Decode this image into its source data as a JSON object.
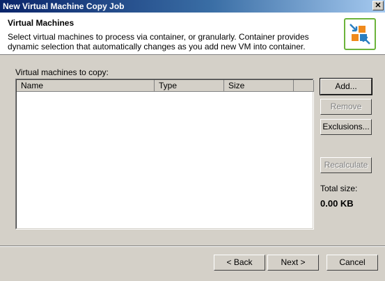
{
  "window": {
    "title": "New Virtual Machine Copy Job",
    "close_icon": "close-icon"
  },
  "header": {
    "title": "Virtual Machines",
    "description": "Select virtual machines to process via container, or granularly. Container provides dynamic selection that automatically changes as you add new VM into container.",
    "logo_icon": "copy-job-arrows-icon"
  },
  "vm_list": {
    "label": "Virtual machines to copy:",
    "columns": [
      "Name",
      "Type",
      "Size"
    ],
    "rows": []
  },
  "side_buttons": {
    "add": "Add...",
    "remove": "Remove",
    "exclusions": "Exclusions...",
    "recalculate": "Recalculate"
  },
  "total": {
    "label": "Total size:",
    "value": "0.00 KB"
  },
  "footer": {
    "back": "< Back",
    "next": "Next >",
    "cancel": "Cancel"
  }
}
